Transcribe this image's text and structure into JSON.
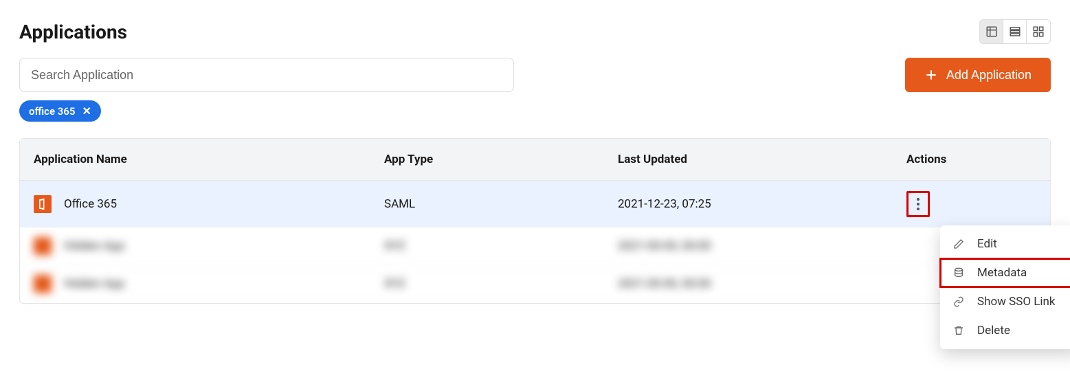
{
  "page_title": "Applications",
  "search": {
    "placeholder": "Search Application"
  },
  "add_button": "Add Application",
  "filter_chip": "office 365",
  "columns": {
    "name": "Application Name",
    "type": "App Type",
    "updated": "Last Updated",
    "actions": "Actions"
  },
  "rows": [
    {
      "name": "Office 365",
      "type": "SAML",
      "updated": "2021-12-23, 07:25"
    }
  ],
  "dropdown": {
    "edit": "Edit",
    "metadata": "Metadata",
    "sso": "Show SSO Link",
    "delete": "Delete"
  }
}
